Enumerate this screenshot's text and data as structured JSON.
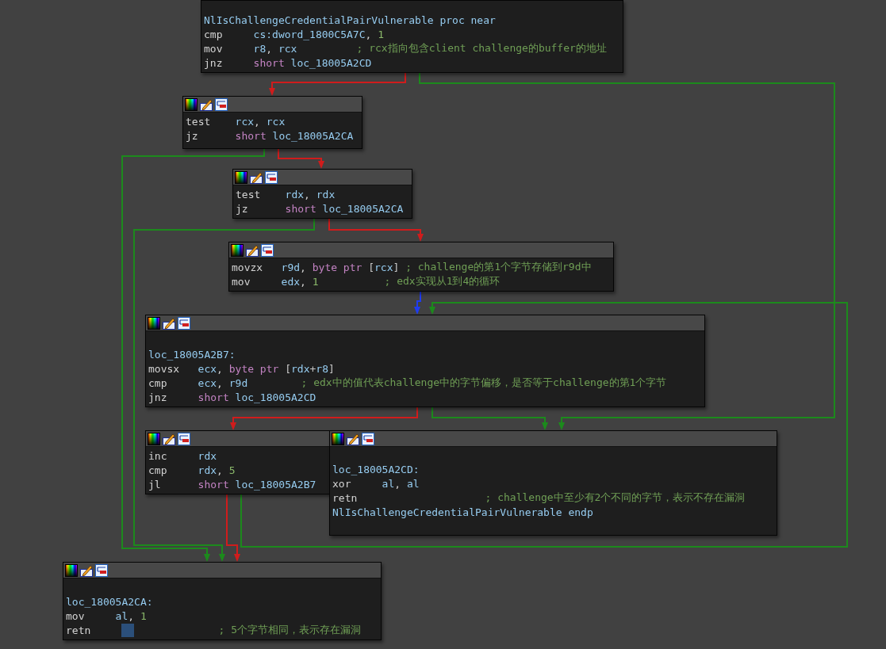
{
  "nodes": [
    {
      "toolbar": false,
      "lines": [
        {
          "tokens": [
            {
              "text": "NlIsChallengeCredentialPairVulnerable",
              "kind": "label"
            },
            {
              "text": "proc near",
              "kind": "directive"
            }
          ]
        },
        {
          "tokens": [
            {
              "text": "cmp",
              "kind": "mnemonic"
            },
            {
              "text": "cs:dword_1800C5A7C",
              "kind": "name"
            },
            {
              "text": ",",
              "kind": "sep"
            },
            {
              "text": "1",
              "kind": "number"
            }
          ]
        },
        {
          "tokens": [
            {
              "text": "mov",
              "kind": "mnemonic"
            },
            {
              "text": "r8",
              "kind": "name"
            },
            {
              "text": ",",
              "kind": "sep"
            },
            {
              "text": "rcx",
              "kind": "name"
            }
          ],
          "comment": "; rcx指向包含client challenge的buffer的地址"
        },
        {
          "tokens": [
            {
              "text": "jnz",
              "kind": "mnemonic"
            },
            {
              "text": "short",
              "kind": "kw"
            },
            {
              "text": "loc_18005A2CD",
              "kind": "name"
            }
          ]
        }
      ]
    },
    {
      "toolbar": true,
      "lines": [
        {
          "tokens": [
            {
              "text": "test",
              "kind": "mnemonic"
            },
            {
              "text": "rcx",
              "kind": "name"
            },
            {
              "text": ",",
              "kind": "sep"
            },
            {
              "text": "rcx",
              "kind": "name"
            }
          ]
        },
        {
          "tokens": [
            {
              "text": "jz",
              "kind": "mnemonic"
            },
            {
              "text": "short",
              "kind": "kw"
            },
            {
              "text": "loc_18005A2CA",
              "kind": "name"
            }
          ]
        }
      ]
    },
    {
      "toolbar": true,
      "lines": [
        {
          "tokens": [
            {
              "text": "test",
              "kind": "mnemonic"
            },
            {
              "text": "rdx",
              "kind": "name"
            },
            {
              "text": ",",
              "kind": "sep"
            },
            {
              "text": "rdx",
              "kind": "name"
            }
          ]
        },
        {
          "tokens": [
            {
              "text": "jz",
              "kind": "mnemonic"
            },
            {
              "text": "short",
              "kind": "kw"
            },
            {
              "text": "loc_18005A2CA",
              "kind": "name"
            }
          ]
        }
      ]
    },
    {
      "toolbar": true,
      "lines": [
        {
          "tokens": [
            {
              "text": "movzx",
              "kind": "mnemonic"
            },
            {
              "text": "r9d",
              "kind": "name"
            },
            {
              "text": ",",
              "kind": "sep"
            },
            {
              "text": "byte ptr",
              "kind": "kw"
            },
            {
              "text": "[",
              "kind": "bracket"
            },
            {
              "text": "rcx",
              "kind": "name"
            },
            {
              "text": "]",
              "kind": "bracket"
            }
          ],
          "comment": "; challenge的第1个字节存储到r9d中"
        },
        {
          "tokens": [
            {
              "text": "mov",
              "kind": "mnemonic"
            },
            {
              "text": "edx",
              "kind": "name"
            },
            {
              "text": ",",
              "kind": "sep"
            },
            {
              "text": "1",
              "kind": "number"
            }
          ],
          "comment": "; edx实现从1到4的循环"
        }
      ]
    },
    {
      "toolbar": true,
      "lines": [
        {
          "tokens": [
            {
              "text": "loc_18005A2B7:",
              "kind": "label"
            }
          ]
        },
        {
          "tokens": [
            {
              "text": "movsx",
              "kind": "mnemonic"
            },
            {
              "text": "ecx",
              "kind": "name"
            },
            {
              "text": ",",
              "kind": "sep"
            },
            {
              "text": "byte ptr",
              "kind": "kw"
            },
            {
              "text": "[",
              "kind": "bracket"
            },
            {
              "text": "rdx",
              "kind": "name"
            },
            {
              "text": "+",
              "kind": "bracket"
            },
            {
              "text": "r8",
              "kind": "name"
            },
            {
              "text": "]",
              "kind": "bracket"
            }
          ]
        },
        {
          "tokens": [
            {
              "text": "cmp",
              "kind": "mnemonic"
            },
            {
              "text": "ecx",
              "kind": "name"
            },
            {
              "text": ",",
              "kind": "sep"
            },
            {
              "text": "r9d",
              "kind": "name"
            }
          ],
          "comment": "; edx中的值代表challenge中的字节偏移，是否等于challenge的第1个字节"
        },
        {
          "tokens": [
            {
              "text": "jnz",
              "kind": "mnemonic"
            },
            {
              "text": "short",
              "kind": "kw"
            },
            {
              "text": "loc_18005A2CD",
              "kind": "name"
            }
          ]
        }
      ]
    },
    {
      "toolbar": true,
      "lines": [
        {
          "tokens": [
            {
              "text": "inc",
              "kind": "mnemonic"
            },
            {
              "text": "rdx",
              "kind": "name"
            }
          ]
        },
        {
          "tokens": [
            {
              "text": "cmp",
              "kind": "mnemonic"
            },
            {
              "text": "rdx",
              "kind": "name"
            },
            {
              "text": ",",
              "kind": "sep"
            },
            {
              "text": "5",
              "kind": "number"
            }
          ]
        },
        {
          "tokens": [
            {
              "text": "jl",
              "kind": "mnemonic"
            },
            {
              "text": "short",
              "kind": "kw"
            },
            {
              "text": "loc_18005A2B7",
              "kind": "name"
            }
          ]
        }
      ]
    },
    {
      "toolbar": true,
      "lines": [
        {
          "tokens": [
            {
              "text": "loc_18005A2CD:",
              "kind": "label"
            }
          ]
        },
        {
          "tokens": [
            {
              "text": "xor",
              "kind": "mnemonic"
            },
            {
              "text": "al",
              "kind": "name"
            },
            {
              "text": ",",
              "kind": "sep"
            },
            {
              "text": "al",
              "kind": "name"
            }
          ]
        },
        {
          "tokens": [
            {
              "text": "retn",
              "kind": "mnemonic"
            }
          ],
          "comment": "; challenge中至少有2个不同的字节，表示不存在漏洞"
        },
        {
          "tokens": [
            {
              "text": "NlIsChallengeCredentialPairVulnerable",
              "kind": "label"
            },
            {
              "text": "endp",
              "kind": "directive"
            }
          ]
        }
      ]
    },
    {
      "toolbar": true,
      "lines": [
        {
          "tokens": [
            {
              "text": "loc_18005A2CA:",
              "kind": "label"
            }
          ]
        },
        {
          "tokens": [
            {
              "text": "mov",
              "kind": "mnemonic"
            },
            {
              "text": "al",
              "kind": "name"
            },
            {
              "text": ",",
              "kind": "sep"
            },
            {
              "text": "1",
              "kind": "number"
            }
          ]
        },
        {
          "tokens": [
            {
              "text": "retn",
              "kind": "mnemonic"
            }
          ],
          "cursor": true,
          "comment": "; 5个字节相同，表示存在漏洞"
        }
      ]
    }
  ],
  "edges": [
    {
      "color": "#d01c1c"
    },
    {
      "color": "#1c8a1c"
    },
    {
      "color": "#1c8a1c"
    },
    {
      "color": "#d01c1c"
    },
    {
      "color": "#1c8a1c"
    },
    {
      "color": "#d01c1c"
    },
    {
      "color": "#1f3cf0"
    },
    {
      "color": "#1c8a1c"
    },
    {
      "color": "#d01c1c"
    },
    {
      "color": "#1c8a1c"
    },
    {
      "color": "#d01c1c"
    }
  ]
}
